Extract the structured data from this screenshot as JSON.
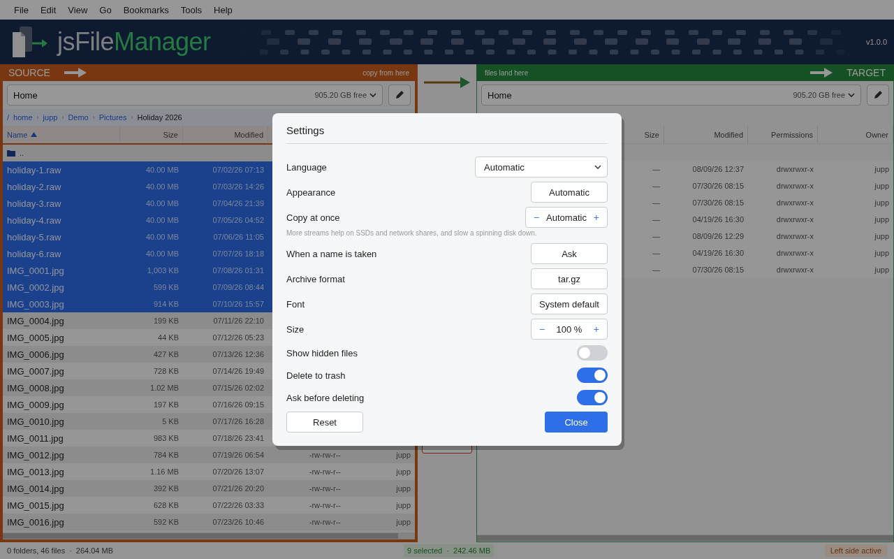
{
  "menu": [
    "File",
    "Edit",
    "View",
    "Go",
    "Bookmarks",
    "Tools",
    "Help"
  ],
  "banner": {
    "app_name_first": "jsFile",
    "app_name_second": "Manager",
    "version": "v1.0.0"
  },
  "source": {
    "label": "SOURCE",
    "hint": "copy from here",
    "location": "Home",
    "free": "905.20 GB free",
    "breadcrumb": [
      {
        "label": "/"
      },
      {
        "label": "home",
        "separator": "›"
      },
      {
        "label": "jupp",
        "separator": "›"
      },
      {
        "label": "Demo",
        "separator": "›"
      },
      {
        "label": "Pictures",
        "separator": "›"
      },
      {
        "label": "Holiday 2026"
      }
    ],
    "columns": [
      {
        "label": "Name",
        "sorted": true
      },
      {
        "label": "Size",
        "sorted": false
      },
      {
        "label": "Modified",
        "sorted": false
      }
    ],
    "parent": "..",
    "rows": [
      {
        "name": "holiday-1.raw",
        "size": "40.00 MB",
        "modified": "07/02/26 07:13",
        "selected": true
      },
      {
        "name": "holiday-2.raw",
        "size": "40.00 MB",
        "modified": "07/03/26 14:26",
        "selected": true
      },
      {
        "name": "holiday-3.raw",
        "size": "40.00 MB",
        "modified": "07/04/26 21:39",
        "selected": true
      },
      {
        "name": "holiday-4.raw",
        "size": "40.00 MB",
        "modified": "07/05/26 04:52",
        "selected": true
      },
      {
        "name": "holiday-5.raw",
        "size": "40.00 MB",
        "modified": "07/06/26 11:05",
        "selected": true
      },
      {
        "name": "holiday-6.raw",
        "size": "40.00 MB",
        "modified": "07/07/26 18:18",
        "selected": true
      },
      {
        "name": "IMG_0001.jpg",
        "size": "1,003 KB",
        "modified": "07/08/26 01:31",
        "selected": true
      },
      {
        "name": "IMG_0002.jpg",
        "size": "599 KB",
        "modified": "07/09/26 08:44",
        "selected": true
      },
      {
        "name": "IMG_0003.jpg",
        "size": "914 KB",
        "modified": "07/10/26 15:57",
        "selected": true
      },
      {
        "name": "IMG_0004.jpg",
        "size": "199 KB",
        "modified": "07/11/26 22:10",
        "selected": false
      },
      {
        "name": "IMG_0005.jpg",
        "size": "44 KB",
        "modified": "07/12/26 05:23",
        "selected": false
      },
      {
        "name": "IMG_0006.jpg",
        "size": "427 KB",
        "modified": "07/13/26 12:36",
        "selected": false
      },
      {
        "name": "IMG_0007.jpg",
        "size": "728 KB",
        "modified": "07/14/26 19:49",
        "selected": false
      },
      {
        "name": "IMG_0008.jpg",
        "size": "1.02 MB",
        "modified": "07/15/26 02:02",
        "selected": false
      },
      {
        "name": "IMG_0009.jpg",
        "size": "197 KB",
        "modified": "07/16/26 09:15",
        "selected": false
      },
      {
        "name": "IMG_0010.jpg",
        "size": "5 KB",
        "modified": "07/17/26 16:28",
        "selected": false
      },
      {
        "name": "IMG_0011.jpg",
        "size": "983 KB",
        "modified": "07/18/26 23:41",
        "selected": false
      },
      {
        "name": "IMG_0012.jpg",
        "size": "784 KB",
        "modified": "07/19/26 06:54",
        "permissions": "-rw-rw-r--",
        "owner": "jupp",
        "selected": false
      },
      {
        "name": "IMG_0013.jpg",
        "size": "1.16 MB",
        "modified": "07/20/26 13:07",
        "permissions": "-rw-rw-r--",
        "owner": "jupp",
        "selected": false
      },
      {
        "name": "IMG_0014.jpg",
        "size": "392 KB",
        "modified": "07/21/26 20:20",
        "permissions": "-rw-rw-r--",
        "owner": "jupp",
        "selected": false
      },
      {
        "name": "IMG_0015.jpg",
        "size": "628 KB",
        "modified": "07/22/26 03:33",
        "permissions": "-rw-rw-r--",
        "owner": "jupp",
        "selected": false
      },
      {
        "name": "IMG_0016.jpg",
        "size": "592 KB",
        "modified": "07/23/26 10:46",
        "permissions": "-rw-rw-r--",
        "owner": "jupp",
        "selected": false
      }
    ]
  },
  "target": {
    "label": "TARGET",
    "hint": "files land here",
    "location": "Home",
    "free": "905.20 GB free",
    "columns": [
      "Size",
      "Modified",
      "Permissions",
      "Owner"
    ],
    "rows": [
      {
        "size": "—",
        "modified": "08/09/26 12:37",
        "permissions": "drwxrwxr-x",
        "owner": "jupp"
      },
      {
        "size": "—",
        "modified": "07/30/26 08:15",
        "permissions": "drwxrwxr-x",
        "owner": "jupp"
      },
      {
        "size": "—",
        "modified": "07/30/26 08:15",
        "permissions": "drwxrwxr-x",
        "owner": "jupp"
      },
      {
        "size": "—",
        "modified": "04/19/26 16:30",
        "permissions": "drwxrwxr-x",
        "owner": "jupp"
      },
      {
        "size": "—",
        "modified": "08/09/26 12:29",
        "permissions": "drwxrwxr-x",
        "owner": "jupp"
      },
      {
        "size": "—",
        "modified": "04/19/26 16:30",
        "permissions": "drwxrwxr-x",
        "owner": "jupp"
      },
      {
        "size": "—",
        "modified": "07/30/26 08:15",
        "permissions": "drwxrwxr-x",
        "owner": "jupp"
      }
    ]
  },
  "status_bar": {
    "counts": "0 folders, 46 files",
    "separator": "·",
    "total": "264.04 MB",
    "selection": "9 selected  ·  242.46 MB",
    "active_side": "Left side active"
  },
  "settings": {
    "title": "Settings",
    "rows": [
      {
        "kind": "select",
        "label": "Language",
        "value": "Automatic"
      },
      {
        "kind": "button",
        "label": "Appearance",
        "value": "Automatic"
      },
      {
        "kind": "stepper",
        "label": "Copy at once",
        "value": "Automatic",
        "minus": "−",
        "plus": "+",
        "hint": "More streams help on SSDs and network shares, and slow a spinning disk down."
      },
      {
        "kind": "button",
        "label": "When a name is taken",
        "value": "Ask"
      },
      {
        "kind": "button",
        "label": "Archive format",
        "value": "tar.gz"
      },
      {
        "kind": "button",
        "label": "Font",
        "value": "System default"
      },
      {
        "kind": "stepper",
        "label": "Size",
        "value": "100 %",
        "minus": "−",
        "plus": "+"
      },
      {
        "kind": "toggle",
        "label": "Show hidden files",
        "on": false
      },
      {
        "kind": "toggle",
        "label": "Delete to trash",
        "on": true
      },
      {
        "kind": "toggle",
        "label": "Ask before deleting",
        "on": true
      }
    ],
    "reset": "Reset",
    "close": "Close"
  }
}
